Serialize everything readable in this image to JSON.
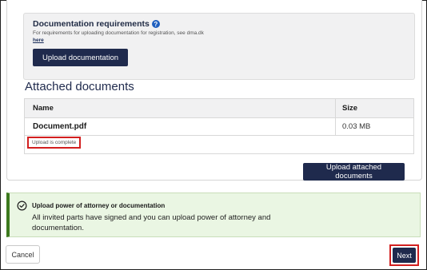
{
  "requirements": {
    "title": "Documentation requirements",
    "help_icon": "?",
    "text": "For requirements for uploading documentation for registration, see dma.dk",
    "link": "here",
    "upload_button": "Upload documentation"
  },
  "attached": {
    "title": "Attached documents",
    "columns": [
      "Name",
      "Size"
    ],
    "rows": [
      {
        "name": "Document.pdf",
        "size": "0.03 MB"
      }
    ],
    "status": "Upload is complete",
    "upload_button": "Upload attached documents"
  },
  "notice": {
    "icon": "check-circle-icon",
    "title": "Upload power of attorney or documentation",
    "text": "All invited parts have signed and you can upload power of attorney and documentation."
  },
  "footer": {
    "cancel": "Cancel",
    "next": "Next"
  },
  "colors": {
    "primary": "#1f2a4d",
    "highlight": "#d21f1f",
    "success_bg": "#eaf6e3",
    "success_border": "#3d7a1f"
  }
}
